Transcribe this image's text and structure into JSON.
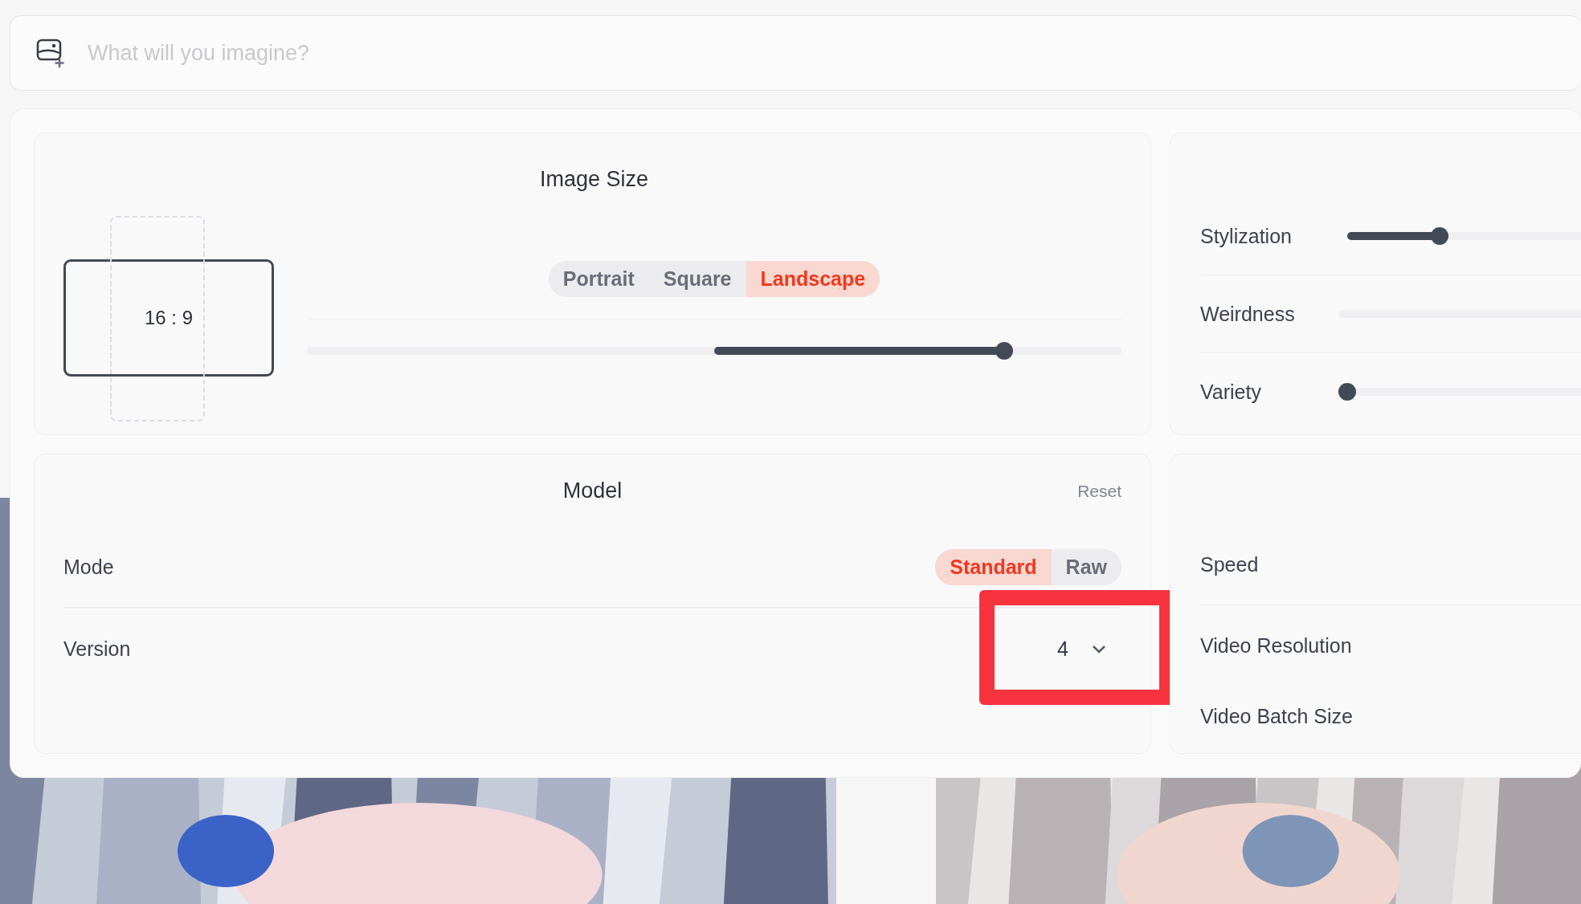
{
  "prompt": {
    "placeholder": "What will you imagine?"
  },
  "image_size": {
    "title": "Image Size",
    "ratio": "16 : 9",
    "orientations": [
      {
        "label": "Portrait",
        "selected": false
      },
      {
        "label": "Square",
        "selected": false
      },
      {
        "label": "Landscape",
        "selected": true
      }
    ],
    "size_slider": {
      "level": 0.856
    }
  },
  "parameters": [
    {
      "label": "Stylization",
      "kind": "slider",
      "level": 0.17
    },
    {
      "label": "Weirdness",
      "kind": "track"
    },
    {
      "label": "Variety",
      "kind": "slider",
      "level": 0
    }
  ],
  "model": {
    "title": "Model",
    "reset": "Reset",
    "rows": [
      {
        "label": "Mode",
        "kind": "toggle",
        "options": [
          {
            "label": "Standard",
            "selected": true
          },
          {
            "label": "Raw",
            "selected": false
          }
        ]
      },
      {
        "label": "Version",
        "kind": "dropdown",
        "value": "4",
        "highlighted": true
      }
    ]
  },
  "video": [
    {
      "label": "Speed"
    },
    {
      "label": "Video Resolution"
    },
    {
      "label": "Video Batch Size"
    }
  ]
}
